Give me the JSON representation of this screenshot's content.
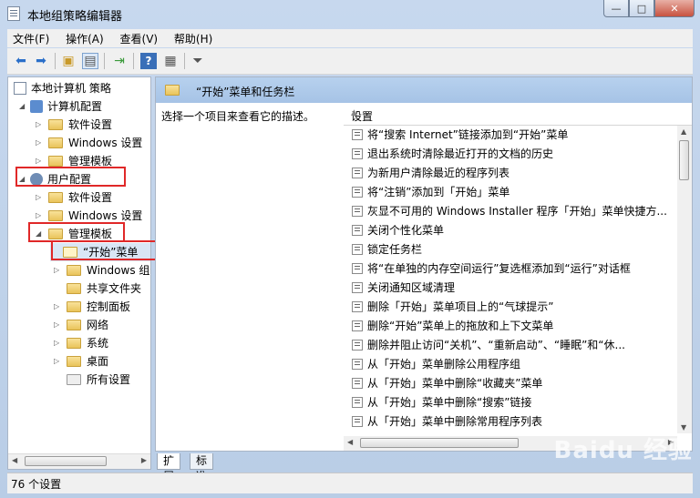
{
  "window": {
    "title": "本地组策略编辑器",
    "controls": {
      "minimize": "—",
      "maximize": "□",
      "close": "✕"
    }
  },
  "menu": [
    "文件(F)",
    "操作(A)",
    "查看(V)",
    "帮助(H)"
  ],
  "toolbar_icons": [
    "back-arrow-icon",
    "forward-arrow-icon",
    "up-folder-icon",
    "show-hide-tree-icon",
    "export-list-icon",
    "help-icon",
    "properties-icon",
    "filter-icon"
  ],
  "tree": {
    "root": "本地计算机 策略",
    "computer_config": "计算机配置",
    "cc_software": "软件设置",
    "cc_windows": "Windows 设置",
    "cc_admin": "管理模板",
    "user_config": "用户配置",
    "uc_software": "软件设置",
    "uc_windows": "Windows 设置",
    "uc_admin": "管理模板",
    "start_menu": "“开始”菜单",
    "windows_comp": "Windows 组件",
    "shared": "共享文件夹",
    "control": "控制面板",
    "network": "网络",
    "system": "系统",
    "desktop": "桌面",
    "all": "所有设置"
  },
  "right": {
    "header": "“开始”菜单和任务栏",
    "description": "选择一个项目来查看它的描述。",
    "column": "设置",
    "items": [
      "将“搜索 Internet”链接添加到“开始”菜单",
      "退出系统时清除最近打开的文档的历史",
      "为新用户清除最近的程序列表",
      "将“注销”添加到「开始」菜单",
      "灰显不可用的 Windows Installer 程序「开始」菜单快捷方...",
      "关闭个性化菜单",
      "锁定任务栏",
      "将“在单独的内存空间运行”复选框添加到“运行”对话框",
      "关闭通知区域清理",
      "删除「开始」菜单项目上的“气球提示”",
      "删除“开始”菜单上的拖放和上下文菜单",
      "删除并阻止访问“关机”、“重新启动”、“睡眠”和“休...",
      "从「开始」菜单删除公用程序组",
      "从「开始」菜单中删除“收藏夹”菜单",
      "从「开始」菜单中删除“搜索”链接",
      "从「开始」菜单中删除常用程序列表"
    ]
  },
  "tabs": [
    "扩展",
    "标准"
  ],
  "status": "76 个设置",
  "watermark": "Baidu 经验"
}
